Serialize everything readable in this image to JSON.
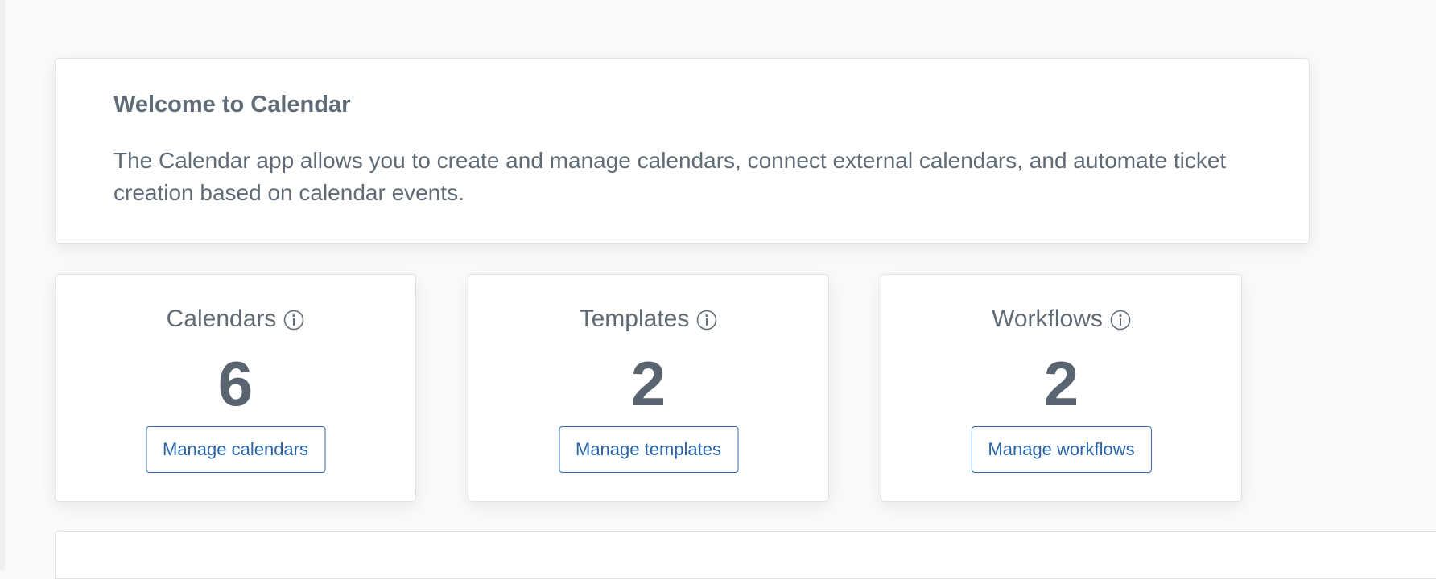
{
  "welcome": {
    "title": "Welcome to Calendar",
    "description": "The Calendar app allows you to create and manage calendars, connect external calendars, and automate ticket creation based on calendar events."
  },
  "stats": [
    {
      "label": "Calendars",
      "value": "6",
      "button_label": "Manage calendars",
      "icon": "info-icon"
    },
    {
      "label": "Templates",
      "value": "2",
      "button_label": "Manage templates",
      "icon": "info-icon"
    },
    {
      "label": "Workflows",
      "value": "2",
      "button_label": "Manage workflows",
      "icon": "info-icon"
    }
  ],
  "colors": {
    "text": "#5f6b76",
    "accent": "#2a64a8",
    "card_border": "#dfe3e6",
    "page_background": "#fafafa"
  }
}
